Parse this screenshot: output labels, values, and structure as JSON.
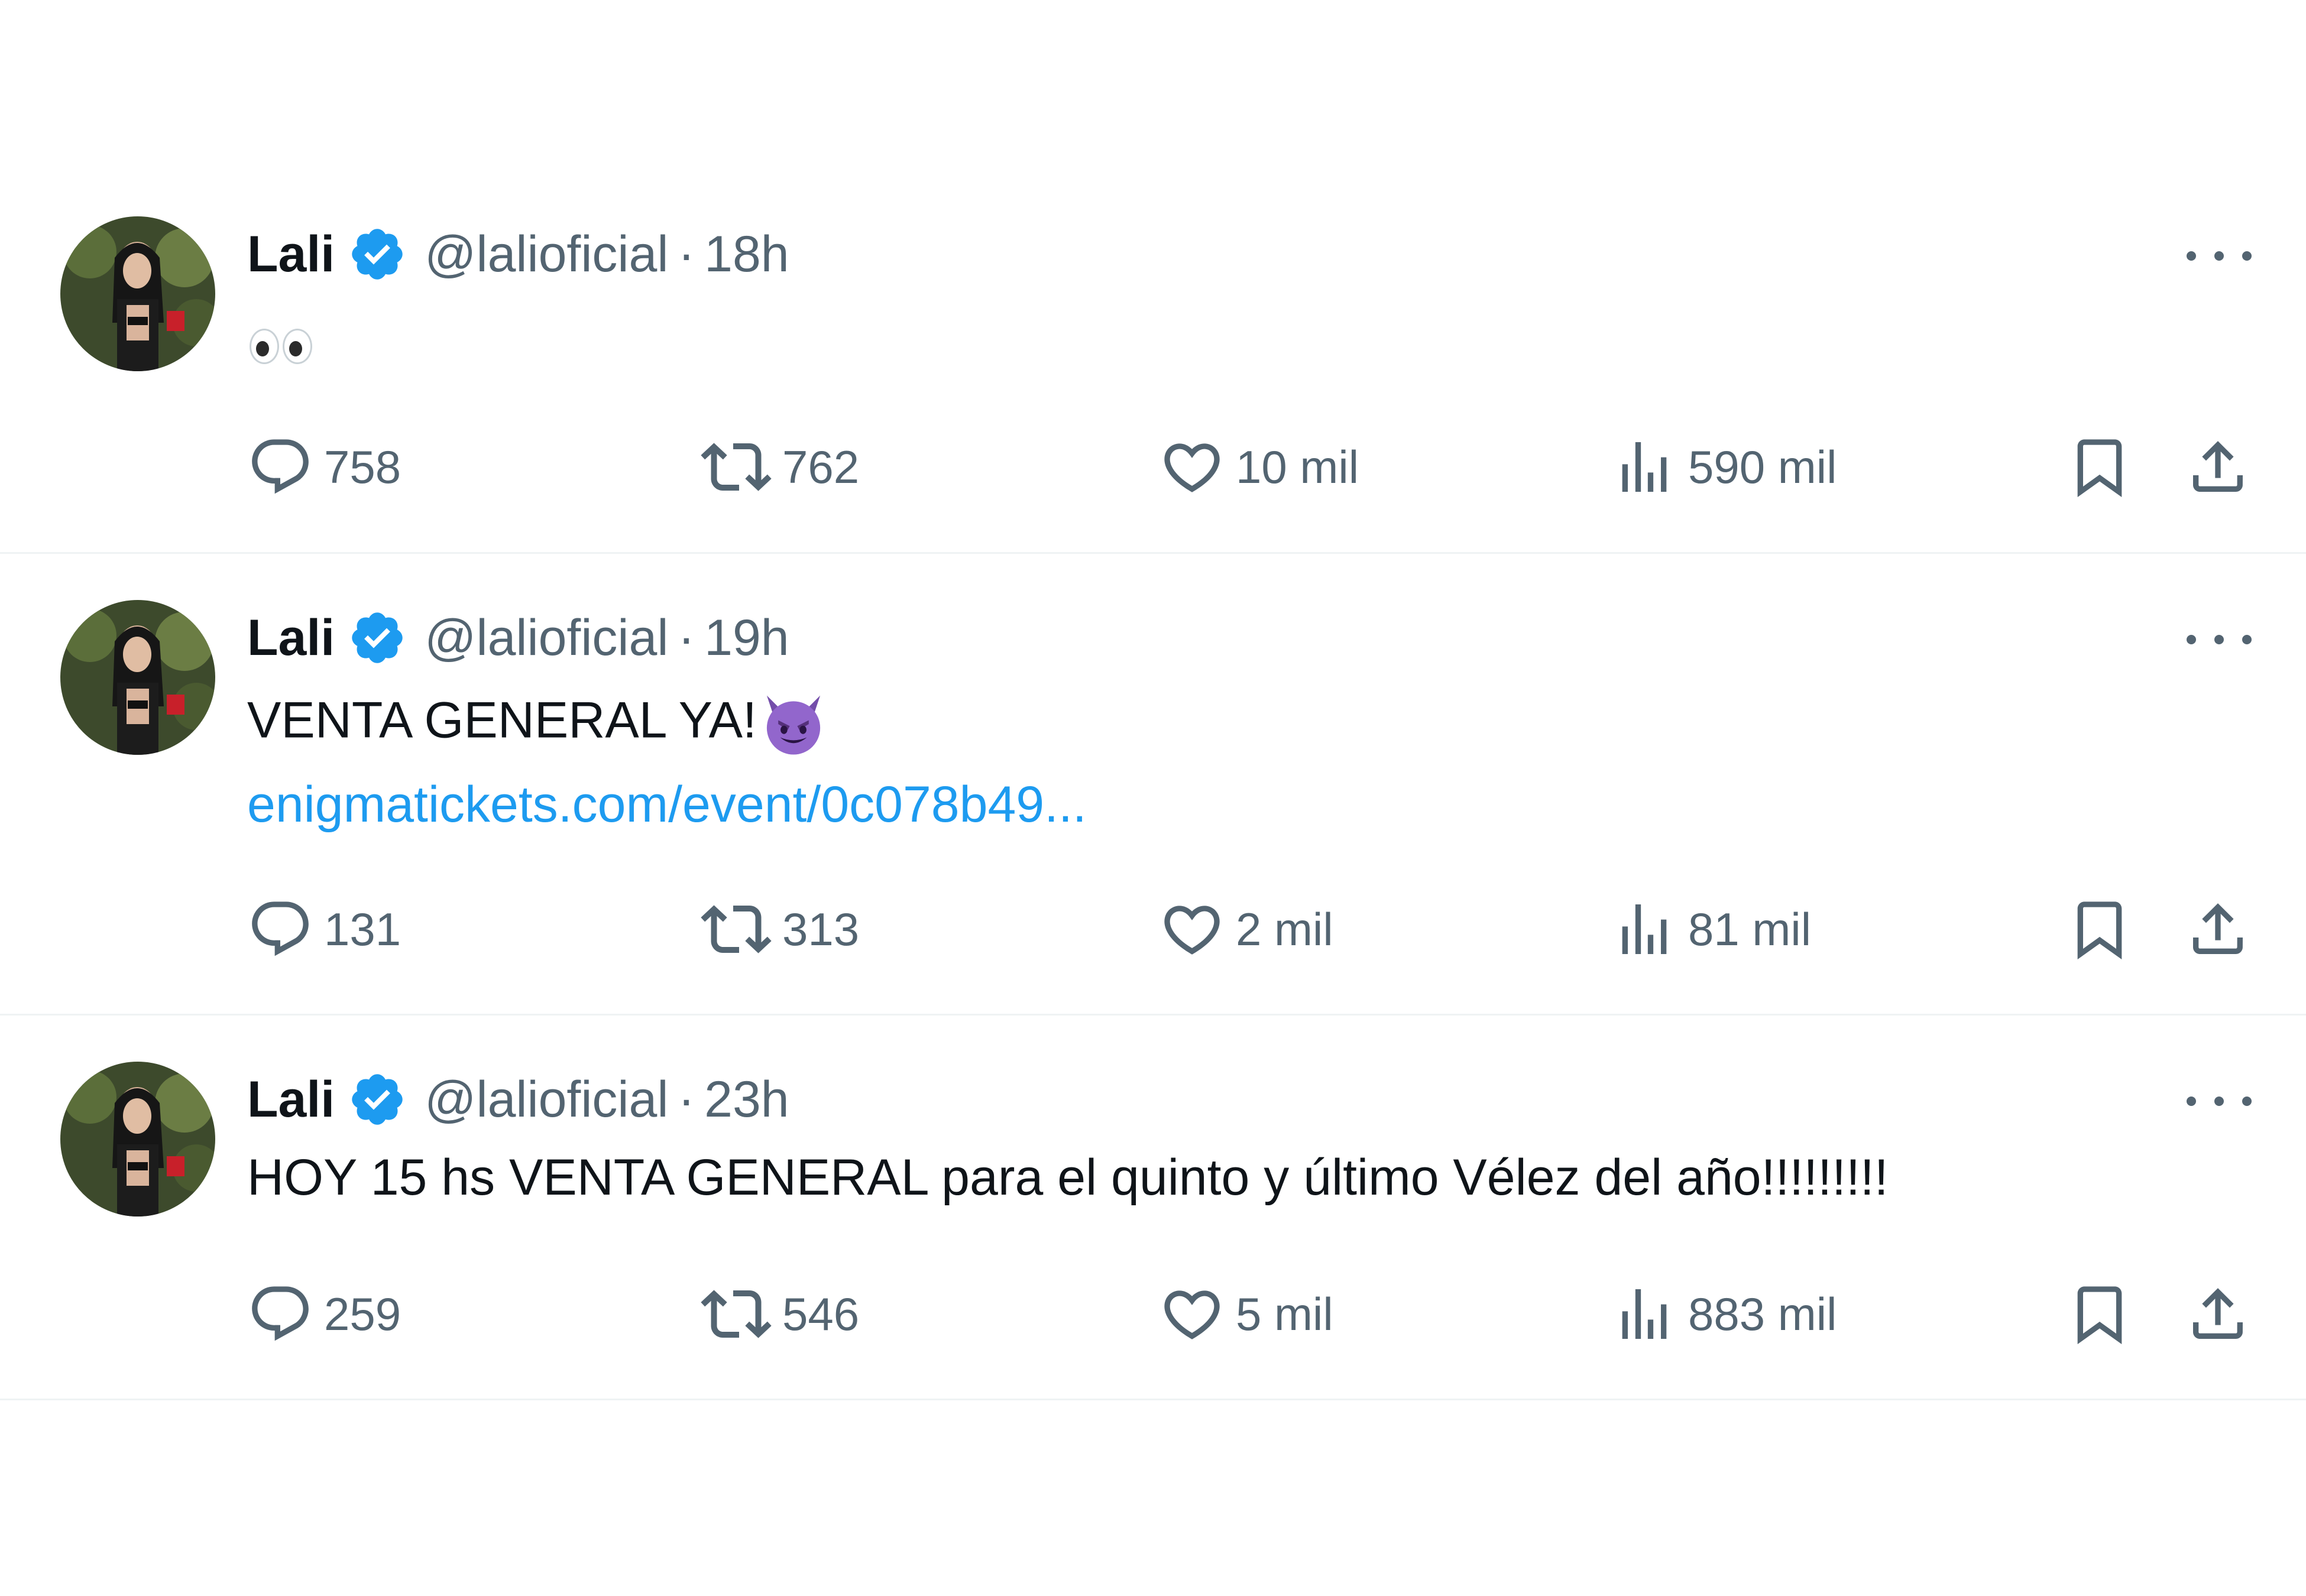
{
  "tweets": [
    {
      "author": {
        "name": "Lali",
        "handle": "@lalioficial"
      },
      "separator": "·",
      "time": "18h",
      "text": "",
      "emoji": "eyes",
      "link": "",
      "stats": {
        "replies": "758",
        "reposts": "762",
        "likes": "10 mil",
        "views": "590 mil"
      }
    },
    {
      "author": {
        "name": "Lali",
        "handle": "@lalioficial"
      },
      "separator": "·",
      "time": "19h",
      "text": "VENTA GENERAL YA!",
      "emoji": "smiling-devil",
      "link": "enigmatickets.com/event/0c078b49...",
      "stats": {
        "replies": "131",
        "reposts": "313",
        "likes": "2 mil",
        "views": "81 mil"
      }
    },
    {
      "author": {
        "name": "Lali",
        "handle": "@lalioficial"
      },
      "separator": "·",
      "time": "23h",
      "text": "HOY 15 hs VENTA GENERAL para el quinto y último Vélez del año!!!!!!!!!",
      "emoji": "",
      "link": "",
      "stats": {
        "replies": "259",
        "reposts": "546",
        "likes": "5 mil",
        "views": "883 mil"
      }
    }
  ],
  "colors": {
    "text_primary": "#0f1419",
    "text_secondary": "#536471",
    "link": "#1d9bf0",
    "verified_badge": "#1d9bf0",
    "divider": "#eff3f4",
    "background": "#ffffff"
  },
  "icons": {
    "reply": "reply-icon",
    "repost": "repost-icon",
    "like": "heart-icon",
    "views": "views-icon",
    "bookmark": "bookmark-icon",
    "share": "share-icon",
    "more": "more-options-icon",
    "verified": "verified-badge-icon"
  }
}
